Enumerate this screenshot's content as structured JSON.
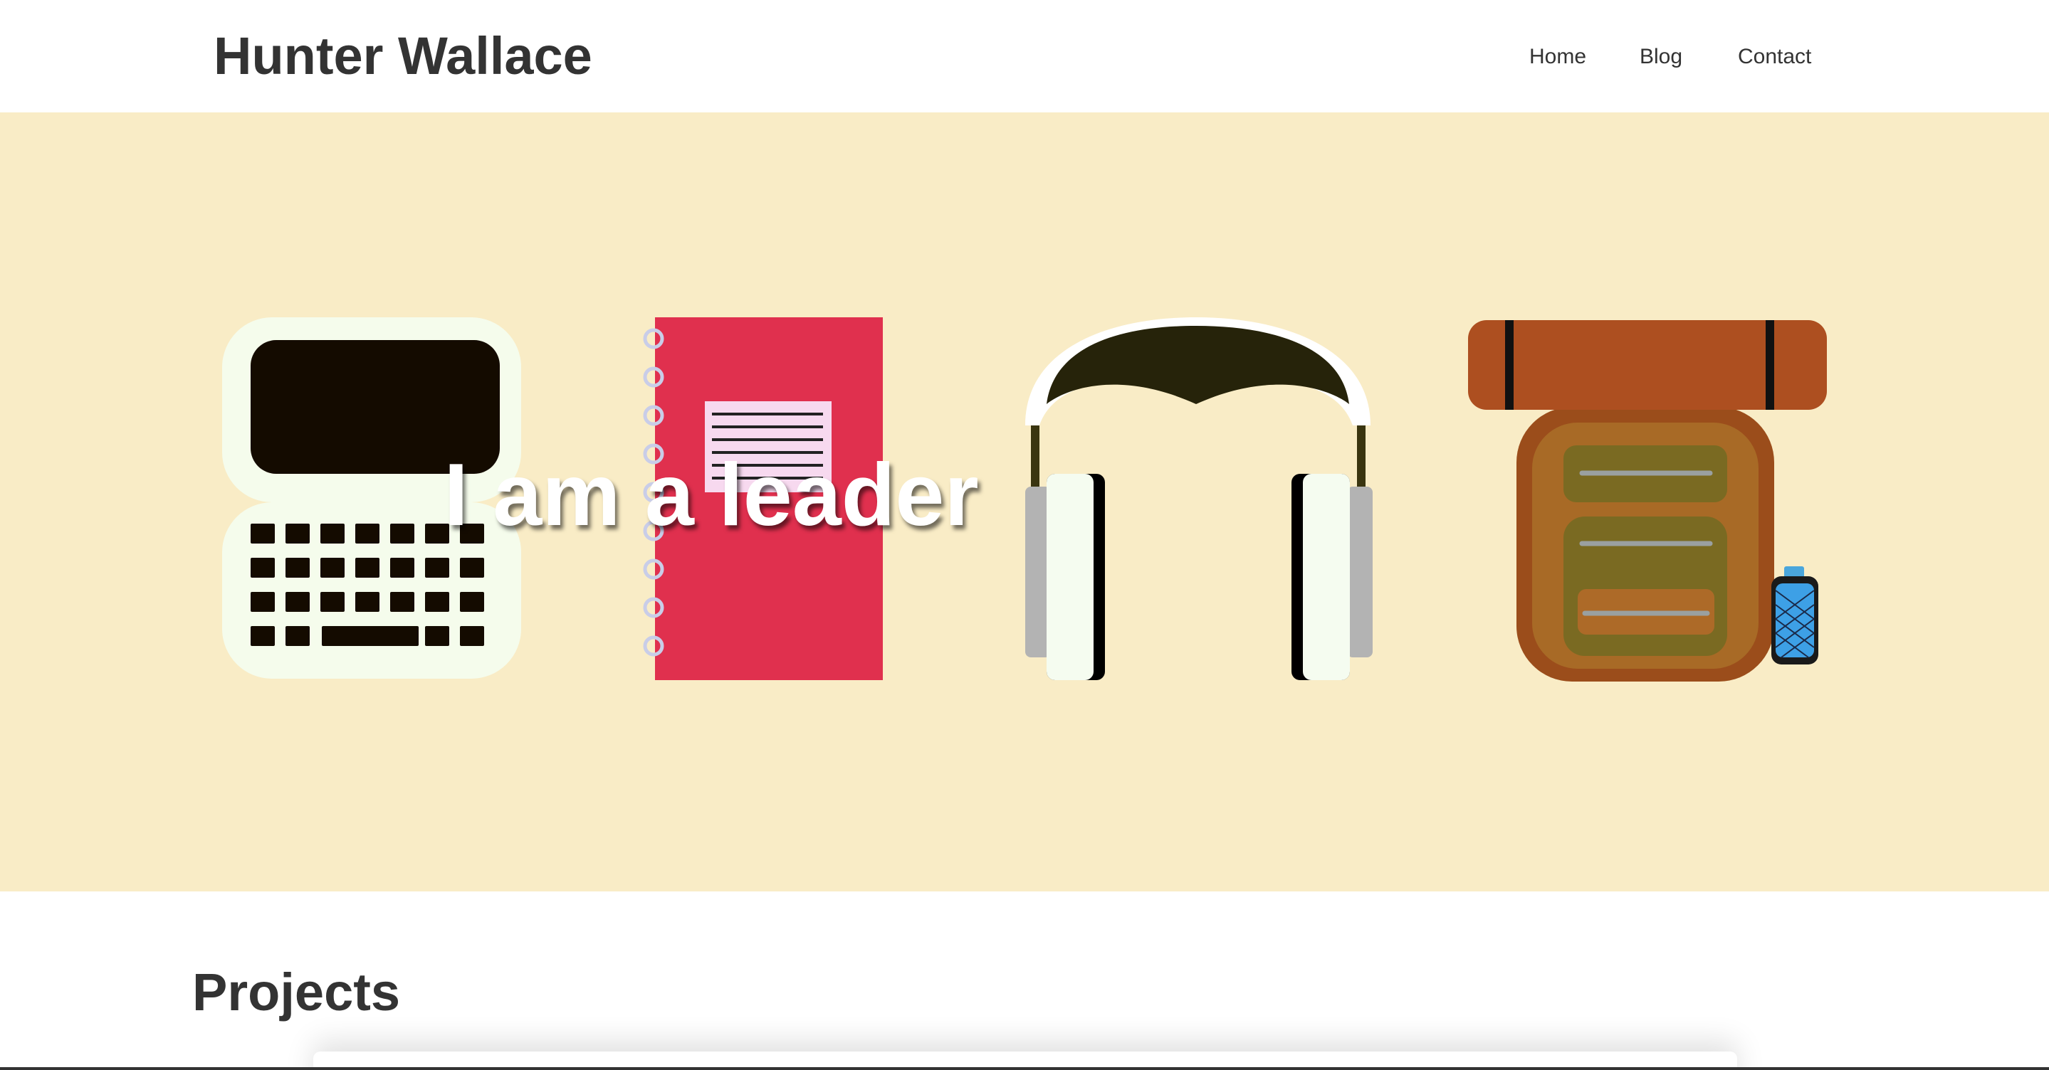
{
  "header": {
    "site_title": "Hunter Wallace",
    "nav": [
      {
        "label": "Home"
      },
      {
        "label": "Blog"
      },
      {
        "label": "Contact"
      }
    ]
  },
  "hero": {
    "headline": "I am a leader",
    "background": "#f9ecc6",
    "illustrations": [
      "laptop-icon",
      "notebook-icon",
      "headphones-icon",
      "backpack-icon"
    ]
  },
  "projects": {
    "heading": "Projects"
  },
  "colors": {
    "text": "#333333",
    "hero_bg": "#f9ecc6",
    "notebook_red": "#e0304e",
    "backpack_rust": "#ad4f20"
  }
}
